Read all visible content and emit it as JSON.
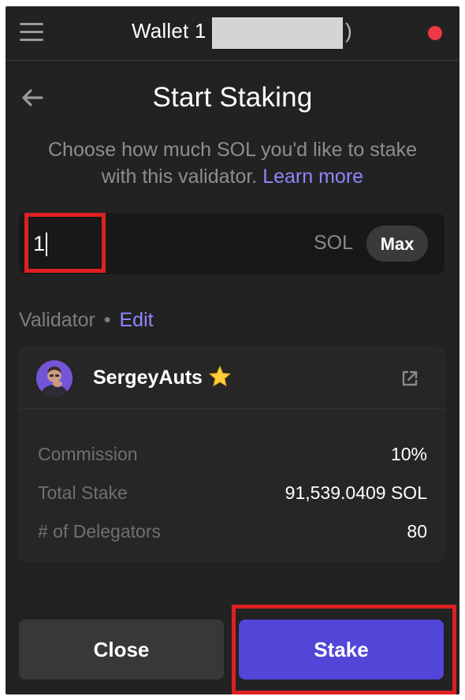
{
  "header": {
    "wallet_name": "Wallet 1",
    "wallet_address_suffix": ")",
    "status_color": "#ee3a46"
  },
  "page": {
    "title": "Start Staking",
    "subtitle": "Choose how much SOL you'd like to stake with this validator.",
    "learn_more": "Learn more"
  },
  "amount": {
    "value": "1",
    "unit": "SOL",
    "max_label": "Max"
  },
  "validator_section": {
    "label": "Validator",
    "separator": "•",
    "edit_label": "Edit"
  },
  "validator": {
    "name": "SergeyAuts",
    "name_icon": "star-icon",
    "stats": [
      {
        "label": "Commission",
        "value": "10%"
      },
      {
        "label": "Total Stake",
        "value": "91,539.0409 SOL"
      },
      {
        "label": "# of Delegators",
        "value": "80"
      }
    ]
  },
  "actions": {
    "close_label": "Close",
    "stake_label": "Stake"
  },
  "colors": {
    "background": "#222222",
    "accent": "#5246d8",
    "link": "#8f86ff",
    "annotation": "#dd2020"
  }
}
